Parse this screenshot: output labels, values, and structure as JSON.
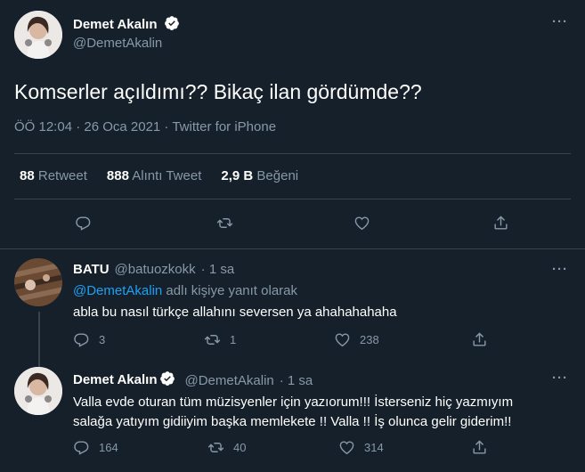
{
  "main_tweet": {
    "author_name": "Demet Akalın",
    "author_handle": "@DemetAkalin",
    "text": "Komserler açıldımı?? Bikaç ilan gördümde??",
    "meta": "ÖÖ 12:04 · 26 Oca 2021 · Twitter for iPhone",
    "stats": {
      "retweets_count": "88",
      "retweets_label": "Retweet",
      "quotes_count": "888",
      "quotes_label": "Alıntı Tweet",
      "likes_count": "2,9 B",
      "likes_label": "Beğeni"
    },
    "more": "···"
  },
  "replies": [
    {
      "author_name": "BATU",
      "author_handle": "@batuozkokk",
      "time": "· 1 sa",
      "reply_to_handle": "@DemetAkalin",
      "reply_to_suffix": " adlı kişiye yanıt olarak",
      "text": "abla bu nasıl türkçe allahını seversen ya ahahahahaha",
      "reply_count": "3",
      "retweet_count": "1",
      "like_count": "238",
      "more": "···"
    },
    {
      "author_name": "Demet Akalın",
      "author_handle": "@DemetAkalin",
      "time": "· 1 sa",
      "text_line1": "Valla evde oturan tüm müzisyenler için yazıorum!!! İsterseniz hiç yazmıyım",
      "text_line2": "salağa yatıyım gidiiyim başka memlekete !! Valla !! İş olunca gelir giderim!!",
      "reply_count": "164",
      "retweet_count": "40",
      "like_count": "314",
      "more": "···"
    }
  ],
  "colors": {
    "background": "#15202b",
    "divider": "#38444d",
    "muted": "#8899a6",
    "link": "#1da1f2",
    "verified": "#1da1f2"
  },
  "icons": [
    "verified-badge-icon",
    "reply-icon",
    "retweet-icon",
    "like-icon",
    "share-icon",
    "more-icon"
  ]
}
